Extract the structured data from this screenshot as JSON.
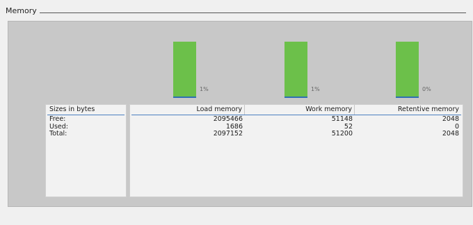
{
  "section": {
    "title": "Memory"
  },
  "gauges": [
    {
      "name": "Load memory",
      "percent_label": "1%",
      "used_fraction": 0.01,
      "color": "#6cc04a"
    },
    {
      "name": "Work memory",
      "percent_label": "1%",
      "used_fraction": 0.01,
      "color": "#6cc04a"
    },
    {
      "name": "Retentive memory",
      "percent_label": "0%",
      "used_fraction": 0.0,
      "color": "#6cc04a"
    }
  ],
  "table": {
    "label_header": "Sizes in bytes",
    "row_labels": [
      "Free:",
      "Used:",
      "Total:"
    ],
    "columns": [
      "Load memory",
      "Work memory",
      "Retentive memory"
    ],
    "rows": [
      [
        "2095466",
        "51148",
        "2048"
      ],
      [
        "1686",
        "52",
        "0"
      ],
      [
        "2097152",
        "51200",
        "2048"
      ]
    ]
  }
}
